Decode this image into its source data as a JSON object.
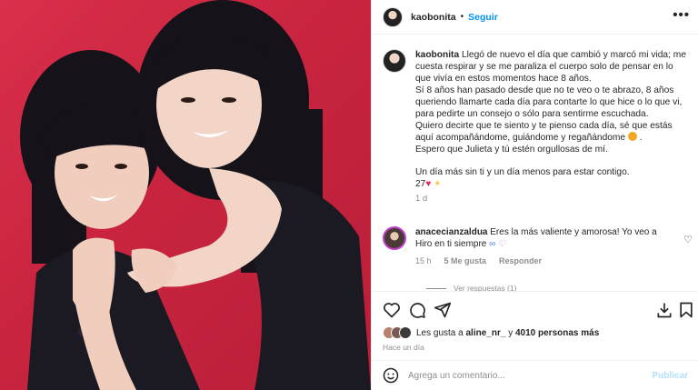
{
  "post": {
    "author": "kaobonita",
    "follow_label": "Seguir",
    "more_label": "•••",
    "separator": "•"
  },
  "caption": {
    "username": "kaobonita",
    "text1": "Llegó de nuevo el día que cambió y marcó mi vida; me cuesta respirar y se me paraliza el cuerpo solo de pensar en lo que vivía en estos momentos hace 8 años.",
    "text2": "Sí 8 años han pasado desde que no te veo o te abrazo, 8 años queriendo llamarte cada día para contarte lo que hice o lo que vi, para pedirte un consejo o sólo para sentirme escuchada.",
    "text3": "Quiero decirte que te siento y te pienso cada día, sé que estás aquí acompañándome, guiándome y regañándome",
    "text4": "Espero que Julieta y tú estén orgullosas de mí.",
    "text5": "Un día más sin ti y un día menos para estar contigo.",
    "text6": "27",
    "time": "1 d"
  },
  "comment": {
    "username": "anacecianzaldua",
    "text": "Eres la más valiente y amorosa! Yo veo a Hiro en ti siempre",
    "time": "15 h",
    "likes": "5 Me gusta",
    "reply": "Responder",
    "view_replies": "Ver respuestas (1)"
  },
  "likes": {
    "prefix": "Les gusta a",
    "user": "aline_nr_",
    "connector": "y",
    "count": "4010 personas más"
  },
  "posted": "Hace un día",
  "composer": {
    "placeholder": "Agrega un comentario...",
    "publish": "Publicar"
  },
  "colors": {
    "accent": "#0095f6",
    "background_photo": "#c9243f",
    "muted": "#8e8e8e"
  }
}
